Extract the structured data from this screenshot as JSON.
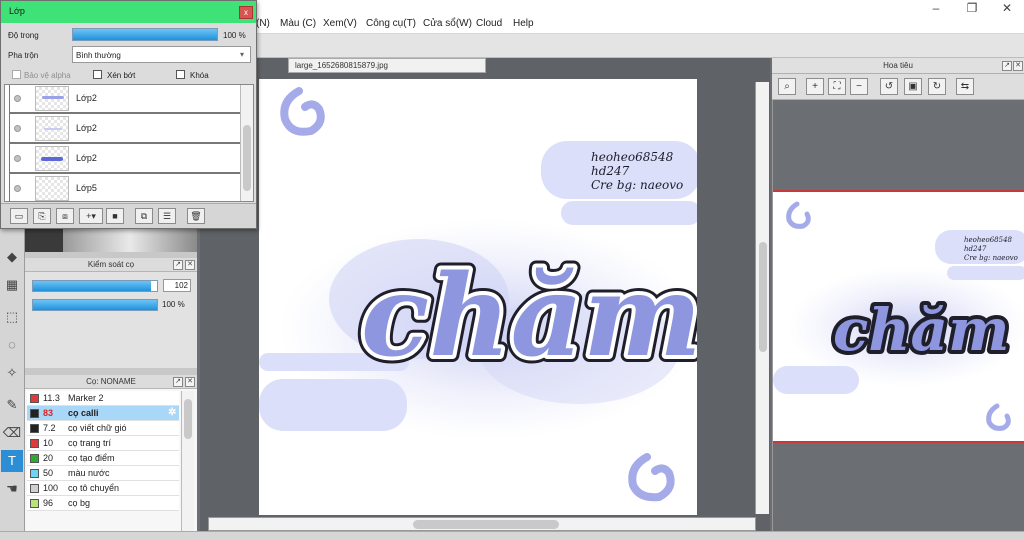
{
  "menubar": {
    "items": [
      "(N)",
      "Màu (C)",
      "Xem(V)",
      "Công cụ(T)",
      "Cửa sổ(W)",
      "Cloud",
      "Help"
    ]
  },
  "layer_window": {
    "title": "Lớp",
    "close_label": "x",
    "opacity_label": "Độ trong",
    "opacity_value": 100,
    "opacity_text": "100 %",
    "blend_label": "Pha trộn",
    "blend_value": "Bình thường",
    "options": [
      "Bảo vệ alpha",
      "Xén bớt",
      "Khóa"
    ],
    "layers": [
      {
        "name": "Lớp2",
        "thumb": "chibi-text"
      },
      {
        "name": "Lớp2",
        "thumb": "faint-text"
      },
      {
        "name": "Lớp2",
        "thumb": "blue-text"
      },
      {
        "name": "Lớp5",
        "thumb": "empty"
      }
    ]
  },
  "brush_control": {
    "title": "Kiểm soát cọ",
    "size_value": "102",
    "size_fill": 0.95,
    "opacity_text": "100 %",
    "opacity_fill": 1.0
  },
  "brush_list": {
    "title": "Cọ: NONAME",
    "items": [
      {
        "size": "11.3",
        "name": "Marker 2",
        "color": "#e03a3a"
      },
      {
        "size": "83",
        "name": "cọ calli",
        "color": "#222222",
        "selected": true
      },
      {
        "size": "7.2",
        "name": "cọ viết chữ gió",
        "color": "#222222"
      },
      {
        "size": "10",
        "name": "cọ trang trí",
        "color": "#e03a3a"
      },
      {
        "size": "20",
        "name": "cọ tạo điểm",
        "color": "#2faa2f"
      },
      {
        "size": "50",
        "name": "màu nước",
        "color": "#6fd4f0"
      },
      {
        "size": "100",
        "name": "cọ tô chuyển",
        "color": "#d0d0d0"
      },
      {
        "size": "96",
        "name": "cọ bg",
        "color": "#b7e37a"
      }
    ]
  },
  "canvas": {
    "tab_label": "large_1652680815879.jpg",
    "artwork": {
      "title": "chăm",
      "credit_lines": [
        "heoheo68548",
        "hd247",
        "Cre bg: naeovo"
      ]
    }
  },
  "navigator": {
    "title": "Hoa tiêu",
    "preview_credit_lines": [
      "heoheo68548",
      "hd247",
      "Cre bg: naeovo"
    ],
    "preview_title": "chăm"
  },
  "colors": {
    "accent_blue": "#2c8fd6",
    "title_green": "#3ee276",
    "art_lavender": "#9aa3e6",
    "nav_frame_red": "#c8383d"
  }
}
